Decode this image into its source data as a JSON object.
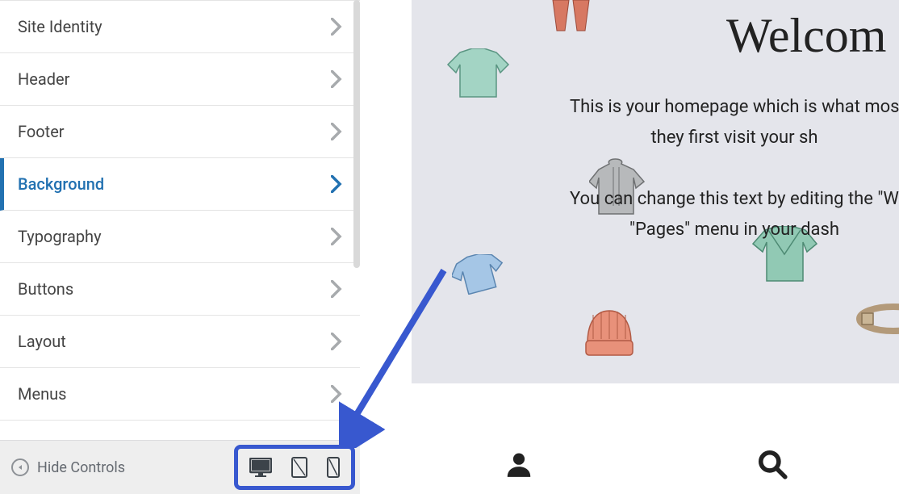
{
  "sidebar": {
    "items": [
      {
        "label": "Site Identity"
      },
      {
        "label": "Header"
      },
      {
        "label": "Footer"
      },
      {
        "label": "Background"
      },
      {
        "label": "Typography"
      },
      {
        "label": "Buttons"
      },
      {
        "label": "Layout"
      },
      {
        "label": "Menus"
      }
    ],
    "hide_controls_label": "Hide Controls"
  },
  "preview": {
    "title": "Welcom",
    "line1": "This is your homepage which is what mos",
    "line2": "they first visit your sh",
    "line3": "You can change this text by editing the \"W",
    "line4": "\"Pages\" menu in your dash"
  }
}
